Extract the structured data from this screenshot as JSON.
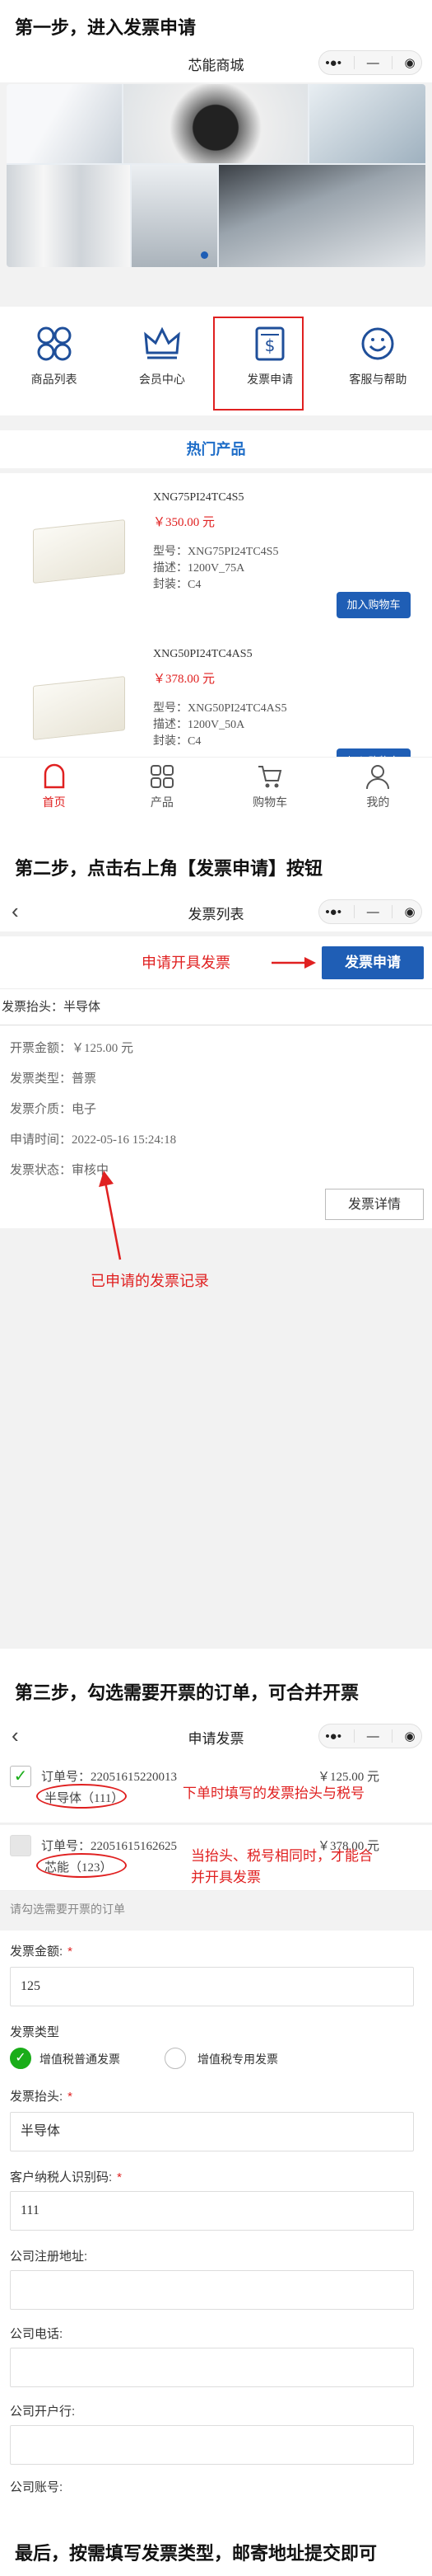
{
  "steps": {
    "s1": "第一步，进入发票申请",
    "s2": "第二步，点击右上角【发票申请】按钮",
    "s3": "第三步，勾选需要开票的订单，可合并开票",
    "s4": "最后，按需填写发票类型，邮寄地址提交即可"
  },
  "screen1": {
    "title": "芯能商城",
    "icons": [
      {
        "label": "商品列表"
      },
      {
        "label": "会员中心"
      },
      {
        "label": "发票申请"
      },
      {
        "label": "客服与帮助"
      }
    ],
    "section": "热门产品",
    "products": [
      {
        "title": "XNG75PI24TC4S5",
        "price": "￥350.00 元",
        "model": "型号：XNG75PI24TC4S5",
        "desc": "描述：1200V_75A",
        "pkg": "封装：C4",
        "btn": "加入购物车"
      },
      {
        "title": "XNG50PI24TC4AS5",
        "price": "￥378.00 元",
        "model": "型号：XNG50PI24TC4AS5",
        "desc": "描述：1200V_50A",
        "pkg": "封装：C4",
        "btn": "加入购物车"
      }
    ],
    "tabs": [
      {
        "label": "首页"
      },
      {
        "label": "产品"
      },
      {
        "label": "购物车"
      },
      {
        "label": "我的"
      }
    ]
  },
  "screen2": {
    "title": "发票列表",
    "annot_apply": "申请开具发票",
    "apply_btn": "发票申请",
    "head": "发票抬头：半导体",
    "rows": [
      "开票金额：￥125.00 元",
      "发票类型：普票",
      "发票介质：电子",
      "申请时间：2022-05-16 15:24:18",
      "发票状态：审核中"
    ],
    "detail_btn": "发票详情",
    "annot_record": "已申请的发票记录"
  },
  "screen3": {
    "title": "申请发票",
    "orders": [
      {
        "no": "订单号：22051615220013",
        "amount": "￥125.00 元",
        "sub": "半导体（111）",
        "checked": "✓"
      },
      {
        "no": "订单号：22051615162625",
        "amount": "￥378.00 元",
        "sub": "芯能（123）",
        "checked": ""
      }
    ],
    "annot1": "下单时填写的发票抬头与税号",
    "annot2a": "当抬头、税号相同时，才能合",
    "annot2b": "并开具发票",
    "hint": "请勾选需要开票的订单",
    "form": {
      "amount_label": "发票金额:",
      "amount_value": "125",
      "type_label": "发票类型",
      "type_opt1": "增值税普通发票",
      "type_opt2": "增值税专用发票",
      "head_label": "发票抬头:",
      "head_value": "半导体",
      "tax_label": "客户纳税人识别码:",
      "tax_value": "111",
      "addr_label": "公司注册地址:",
      "phone_label": "公司电话:",
      "bank_label": "公司开户行:",
      "acct_label": "公司账号:"
    }
  },
  "colors": {
    "accent": "#1f5eb5",
    "annotation": "#e02020",
    "check": "#1aad19",
    "section": "#1e6dc8"
  }
}
